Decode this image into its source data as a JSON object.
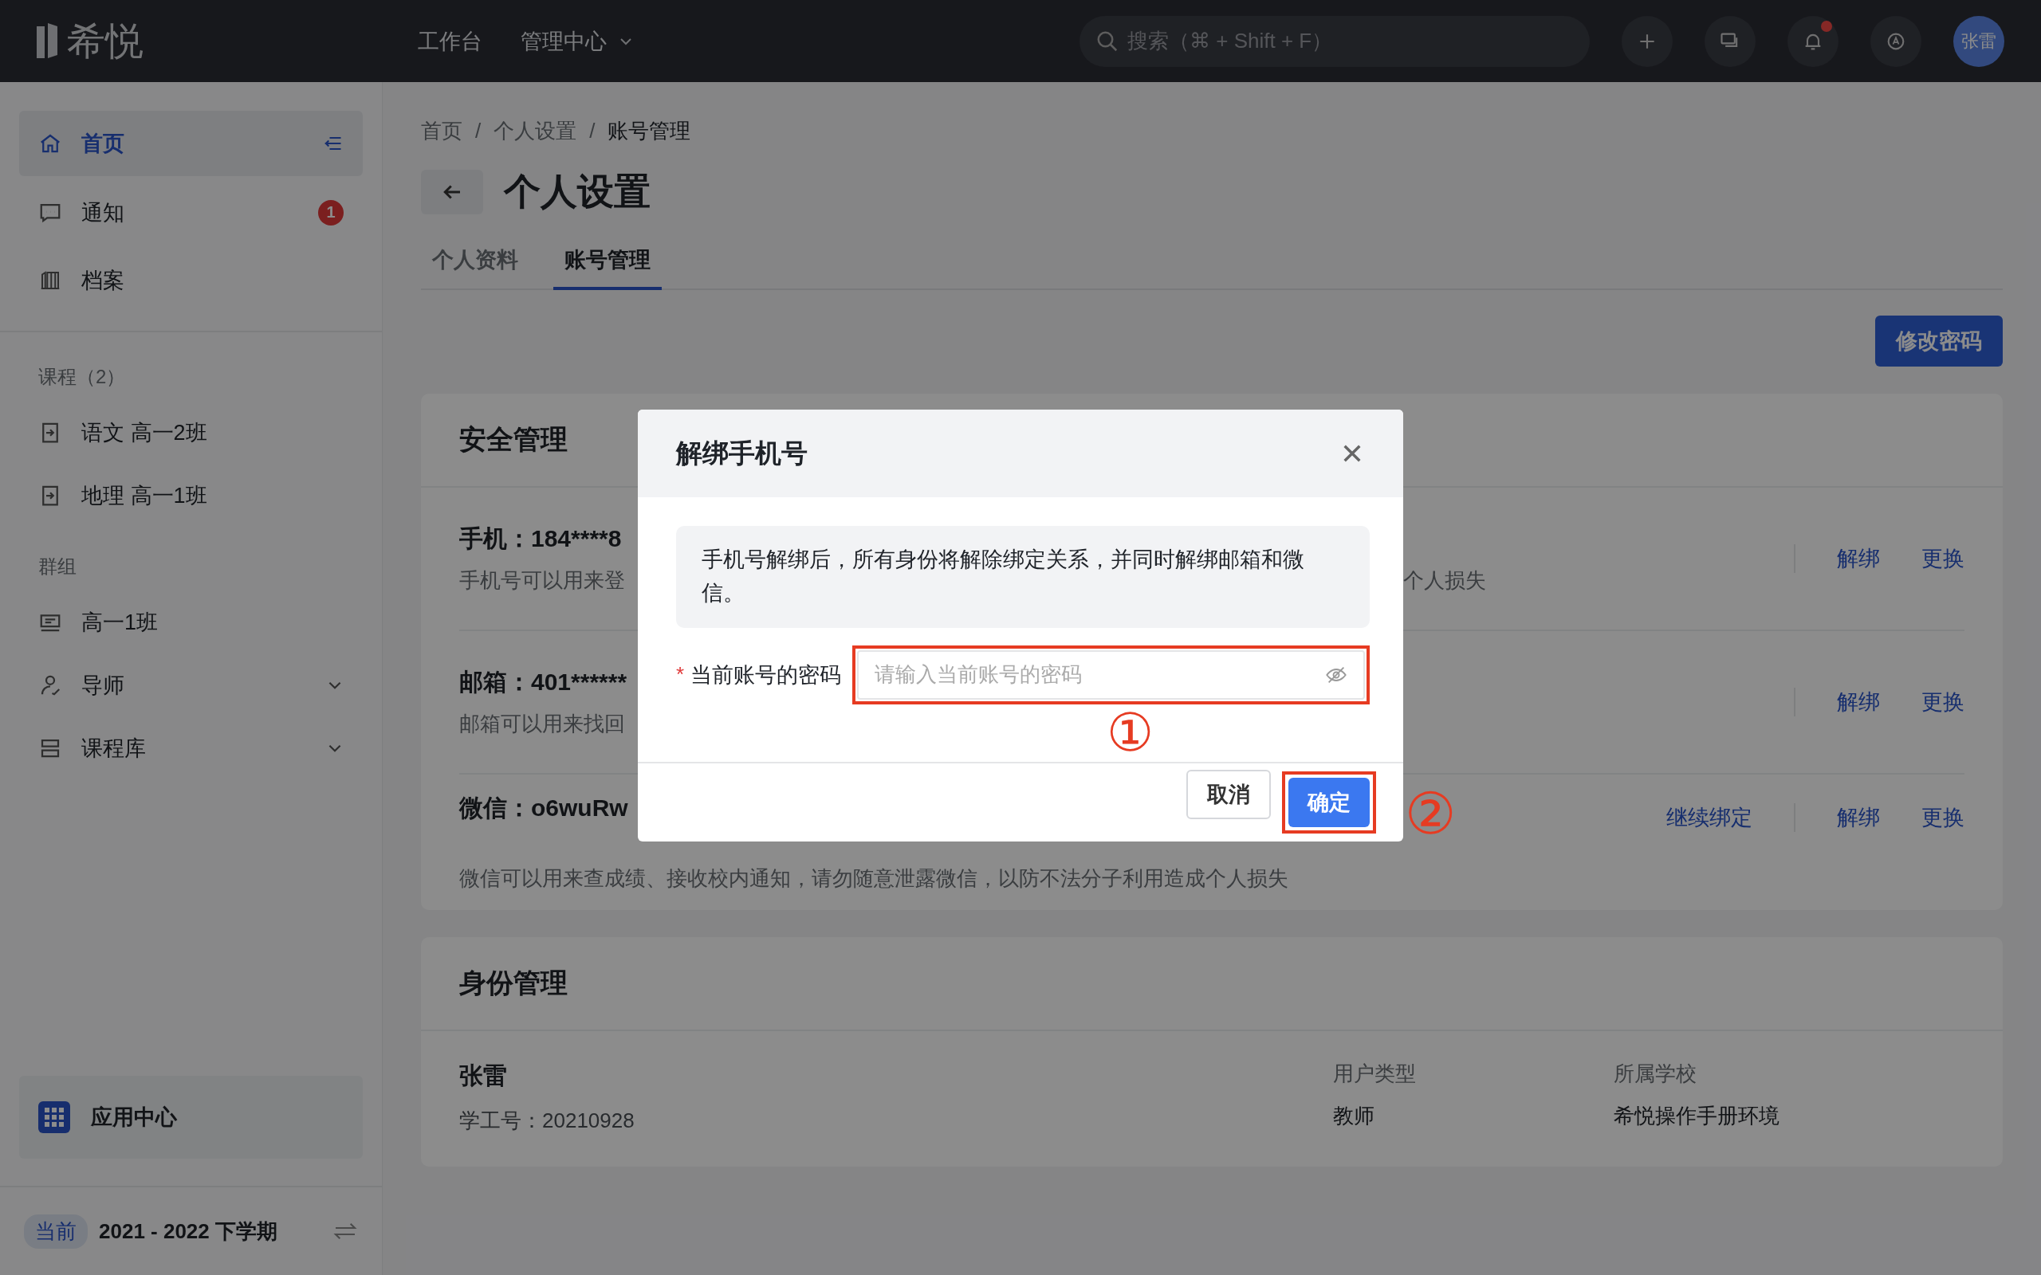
{
  "top_bar": {
    "logo": "希悦",
    "nav": [
      {
        "label": "工作台",
        "dropdown": false
      },
      {
        "label": "管理中心",
        "dropdown": true
      }
    ],
    "search": {
      "placeholder": "搜索（⌘ + Shift + F）"
    },
    "notifications_unread": true,
    "avatar": "张雷"
  },
  "sidebar": {
    "items": [
      {
        "label": "首页",
        "selected": true
      },
      {
        "label": "通知",
        "selected": false,
        "badge": "1"
      },
      {
        "label": "档案",
        "selected": false
      }
    ],
    "sections": [
      {
        "title": "课程（2）",
        "items": [
          {
            "label": "语文 高一2班",
            "expandable": false
          },
          {
            "label": "地理 高一1班",
            "expandable": false
          }
        ]
      },
      {
        "title": "群组",
        "items": [
          {
            "label": "高一1班",
            "expandable": false
          },
          {
            "label": "导师",
            "expandable": true
          },
          {
            "label": "课程库",
            "expandable": true
          }
        ]
      }
    ],
    "app_center": "应用中心",
    "term": {
      "tag": "当前",
      "label": "2021 - 2022 下学期"
    }
  },
  "breadcrumb": {
    "items": [
      "首页",
      "个人设置",
      "账号管理"
    ],
    "separators": [
      "/",
      "/"
    ]
  },
  "page_title": "个人设置",
  "tabs": [
    {
      "label": "个人资料",
      "selected": false
    },
    {
      "label": "账号管理",
      "selected": true
    }
  ],
  "change_password_button": "修改密码",
  "security": {
    "title": "安全管理",
    "rows": [
      {
        "label": "手机：184****8",
        "desc_start": "手机号可以用来登",
        "desc_end": "个人损失",
        "actions": [
          "解绑",
          "更换"
        ]
      },
      {
        "label": "邮箱：401******",
        "desc_start": "邮箱可以用来找回",
        "actions": [
          "解绑",
          "更换"
        ]
      },
      {
        "label": "微信：o6wuRw",
        "desc_start": "微信可以用来查成绩、接收校内通知，请勿随意泄露微信，以防不法分子利用造成个人损失",
        "actions": [
          "继续绑定",
          "解绑",
          "更换"
        ]
      }
    ]
  },
  "identity": {
    "title": "身份管理",
    "name": "张雷",
    "id_line": "学工号：20210928",
    "columns": [
      {
        "header": "用户类型",
        "value": "教师"
      },
      {
        "header": "所属学校",
        "value": "希悦操作手册环境"
      }
    ]
  },
  "dialog": {
    "title": "解绑手机号",
    "notice": "手机号解绑后，所有身份将解除绑定关系，并同时解绑邮箱和微信。",
    "field": {
      "required_mark": "*",
      "label": "当前账号的密码",
      "placeholder": "请输入当前账号的密码"
    },
    "buttons": [
      {
        "label": "取消",
        "primary": false
      },
      {
        "label": "确定",
        "primary": true
      }
    ]
  },
  "annotations": [
    "①",
    "②"
  ]
}
